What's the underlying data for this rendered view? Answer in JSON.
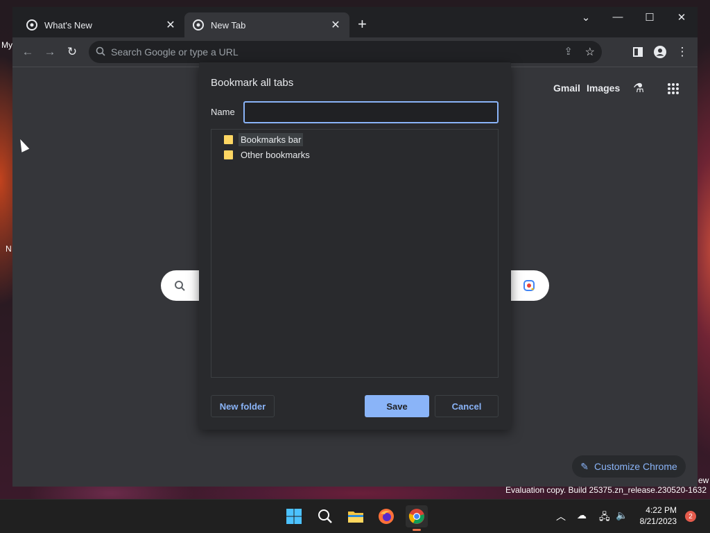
{
  "desktop": {
    "labels": [
      "My",
      "N"
    ],
    "watermark_partial": "ew",
    "evaluation_text": "Evaluation copy. Build 25375.zn_release.230520-1632"
  },
  "browser": {
    "tabs": [
      {
        "title": "What's New",
        "active": false
      },
      {
        "title": "New Tab",
        "active": true
      }
    ],
    "omnibox_placeholder": "Search Google or type a URL",
    "ntp": {
      "gmail_label": "Gmail",
      "images_label": "Images",
      "customize_label": "Customize Chrome"
    }
  },
  "dialog": {
    "title": "Bookmark all tabs",
    "name_label": "Name",
    "name_value": "",
    "folders": [
      {
        "label": "Bookmarks bar",
        "selected": true
      },
      {
        "label": "Other bookmarks",
        "selected": false
      }
    ],
    "new_folder_label": "New folder",
    "save_label": "Save",
    "cancel_label": "Cancel"
  },
  "taskbar": {
    "time": "4:22 PM",
    "date": "8/21/2023",
    "notification_count": "2"
  },
  "colors": {
    "accent": "#8ab4f8",
    "folder": "#fdd663",
    "dialog_bg": "#292a2d",
    "window_bg": "#35363a"
  }
}
